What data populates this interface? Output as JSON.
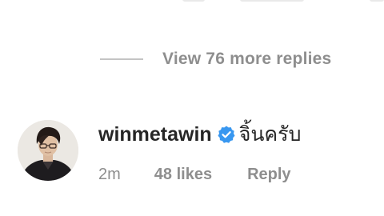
{
  "replies": {
    "view_more_label": "View 76 more replies"
  },
  "comment": {
    "username": "winmetawin",
    "verified": true,
    "text": "จิ้นครับ",
    "time": "2m",
    "likes": "48 likes",
    "reply_label": "Reply"
  },
  "icons": {
    "verified": "verified-badge-icon",
    "avatar": "profile-photo"
  },
  "colors": {
    "primary_text": "#262626",
    "secondary_text": "#8e8e8e",
    "verified_blue": "#3897f0",
    "divider": "#c4c4c4"
  }
}
